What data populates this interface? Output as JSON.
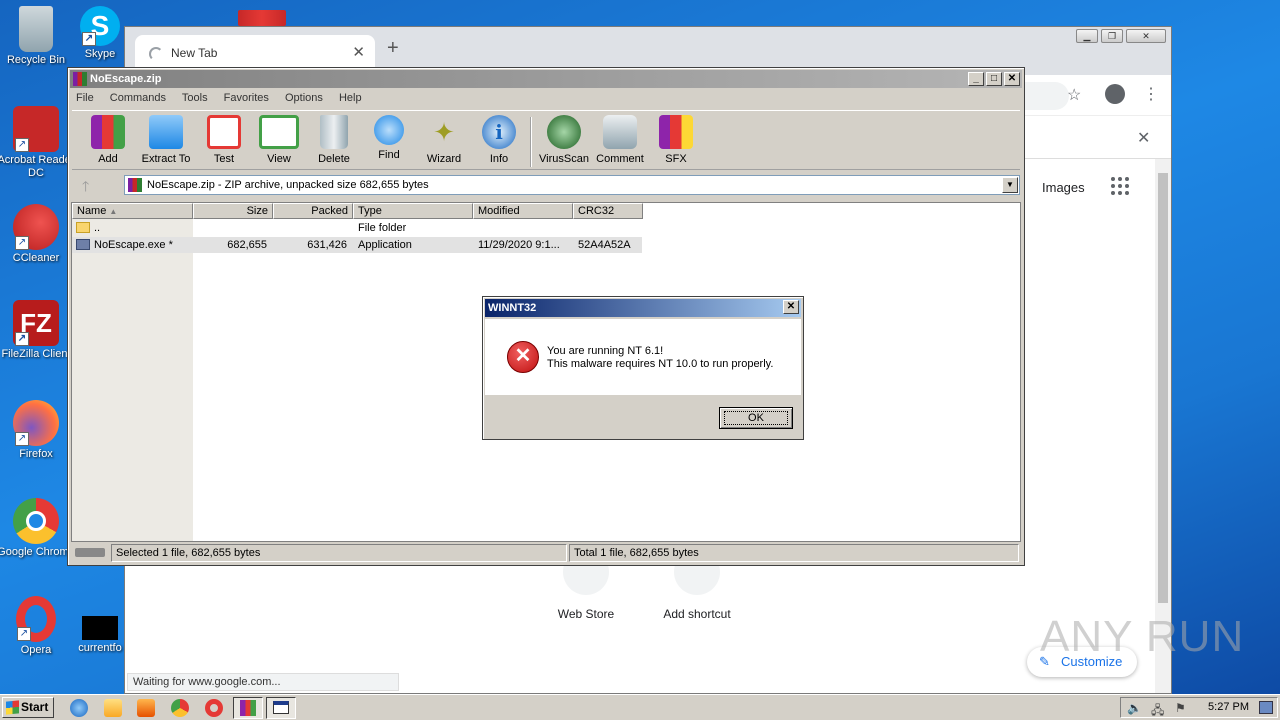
{
  "desktop": {
    "icons": [
      {
        "label": "Recycle Bin"
      },
      {
        "label": "Skype"
      },
      {
        "label": "Acrobat Reader DC"
      },
      {
        "label": "CCleaner"
      },
      {
        "label": "FileZilla Client"
      },
      {
        "label": "Firefox"
      },
      {
        "label": "Google Chrome"
      },
      {
        "label": "Opera"
      },
      {
        "label": "currentfo"
      }
    ]
  },
  "browser": {
    "tab_title": "New Tab",
    "images_link": "Images",
    "shortcuts": [
      {
        "label": "Web Store"
      },
      {
        "label": "Add shortcut"
      }
    ],
    "customize_label": "Customize",
    "status_text": "Waiting for www.google.com...",
    "watermark": "ANY RUN"
  },
  "winrar": {
    "title": "NoEscape.zip",
    "menu": [
      "File",
      "Commands",
      "Tools",
      "Favorites",
      "Options",
      "Help"
    ],
    "toolbar": [
      {
        "label": "Add",
        "icon": "add-archive-icon",
        "color": "#8e24aa"
      },
      {
        "label": "Extract To",
        "icon": "extract-folder-icon",
        "color": "#42a5f5"
      },
      {
        "label": "Test",
        "icon": "test-checklist-icon",
        "color": "#e53935"
      },
      {
        "label": "View",
        "icon": "view-book-icon",
        "color": "#43a047"
      },
      {
        "label": "Delete",
        "icon": "trash-can-icon",
        "color": "#90a4ae"
      },
      {
        "label": "Find",
        "icon": "magnifier-icon",
        "color": "#1e88e5"
      },
      {
        "label": "Wizard",
        "icon": "magic-wand-icon",
        "color": "#c0ca33"
      },
      {
        "label": "Info",
        "icon": "info-icon",
        "color": "#1565c0"
      },
      {
        "label": "VirusScan",
        "icon": "bug-scan-icon",
        "color": "#2e7d32"
      },
      {
        "label": "Comment",
        "icon": "comment-icon",
        "color": "#78909c"
      },
      {
        "label": "SFX",
        "icon": "sfx-archive-icon",
        "color": "#f4511e"
      }
    ],
    "path": "NoEscape.zip - ZIP archive, unpacked size 682,655 bytes",
    "columns": [
      "Name",
      "Size",
      "Packed",
      "Type",
      "Modified",
      "CRC32"
    ],
    "rows": [
      {
        "name": "..",
        "size": "",
        "packed": "",
        "type": "File folder",
        "modified": "",
        "crc": ""
      },
      {
        "name": "NoEscape.exe *",
        "size": "682,655",
        "packed": "631,426",
        "type": "Application",
        "modified": "11/29/2020 9:1...",
        "crc": "52A4A52A"
      }
    ],
    "status_left": "Selected 1 file, 682,655 bytes",
    "status_right": "Total 1 file, 682,655 bytes"
  },
  "dialog": {
    "title": "WINNT32",
    "line1": "You are running NT 6.1!",
    "line2": "This malware requires NT 10.0 to run properly.",
    "ok_label": "OK"
  },
  "taskbar": {
    "start_label": "Start",
    "clock": "5:27 PM"
  }
}
